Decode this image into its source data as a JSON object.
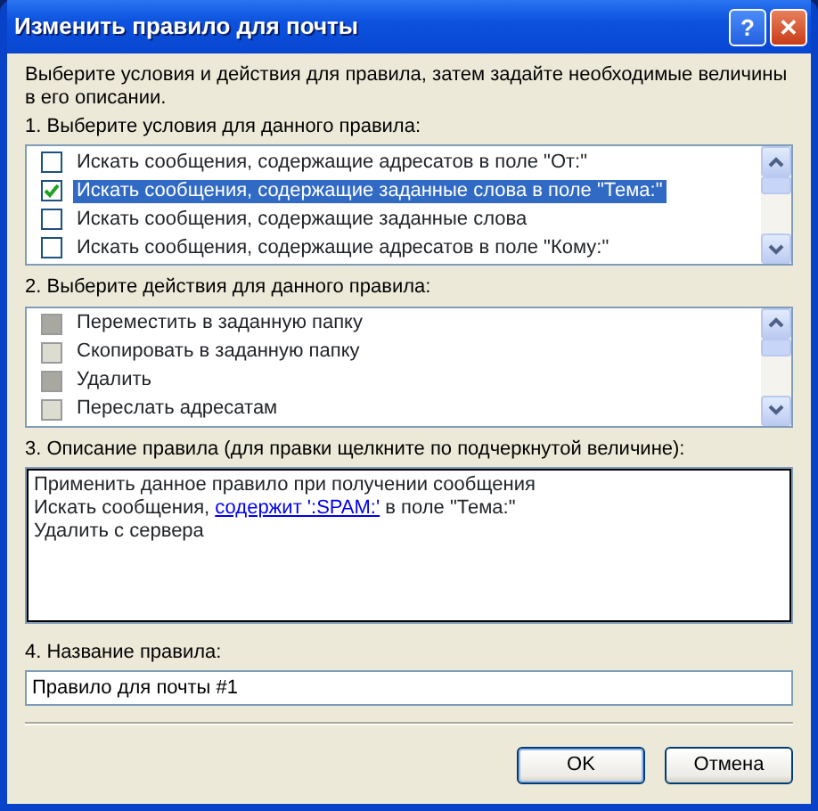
{
  "window": {
    "title": "Изменить правило для почты",
    "buttons": [
      "?",
      "✕"
    ]
  },
  "intro": "Выберите условия и действия для правила, затем задайте необходимые величины в его описании.",
  "conditions": {
    "label": "1. Выберите условия для данного правила:",
    "items": [
      {
        "text": "Искать сообщения, содержащие адресатов в поле \"От:\"",
        "checked": false,
        "selected": false
      },
      {
        "text": "Искать сообщения, содержащие заданные слова в поле \"Тема:\"",
        "checked": true,
        "selected": true
      },
      {
        "text": "Искать сообщения, содержащие заданные слова",
        "checked": false,
        "selected": false
      },
      {
        "text": "Искать сообщения, содержащие адресатов в поле \"Кому:\"",
        "checked": false,
        "selected": false
      }
    ]
  },
  "actions": {
    "label": "2. Выберите действия для данного правила:",
    "items": [
      {
        "text": "Переместить в заданную папку",
        "disabled": true
      },
      {
        "text": "Скопировать в заданную папку",
        "disabled": false
      },
      {
        "text": "Удалить",
        "disabled": true
      },
      {
        "text": "Переслать адресатам",
        "disabled": false
      }
    ]
  },
  "description": {
    "label": "3. Описание правила (для правки щелкните по подчеркнутой величине):",
    "lines": [
      {
        "kind": "text",
        "text": "Применить данное правило при получении сообщения"
      },
      {
        "kind": "link",
        "before": "Искать сообщения, ",
        "link": "содержит ':SPAM:'",
        "after": " в поле \"Тема:\""
      },
      {
        "kind": "text",
        "text": "Удалить с сервера"
      }
    ]
  },
  "rule_name": {
    "label": "4. Название правила:",
    "value": "Правило для почты #1"
  },
  "buttons": [
    {
      "label": "OK",
      "default": true
    },
    {
      "label": "Отмена",
      "default": false
    }
  ]
}
